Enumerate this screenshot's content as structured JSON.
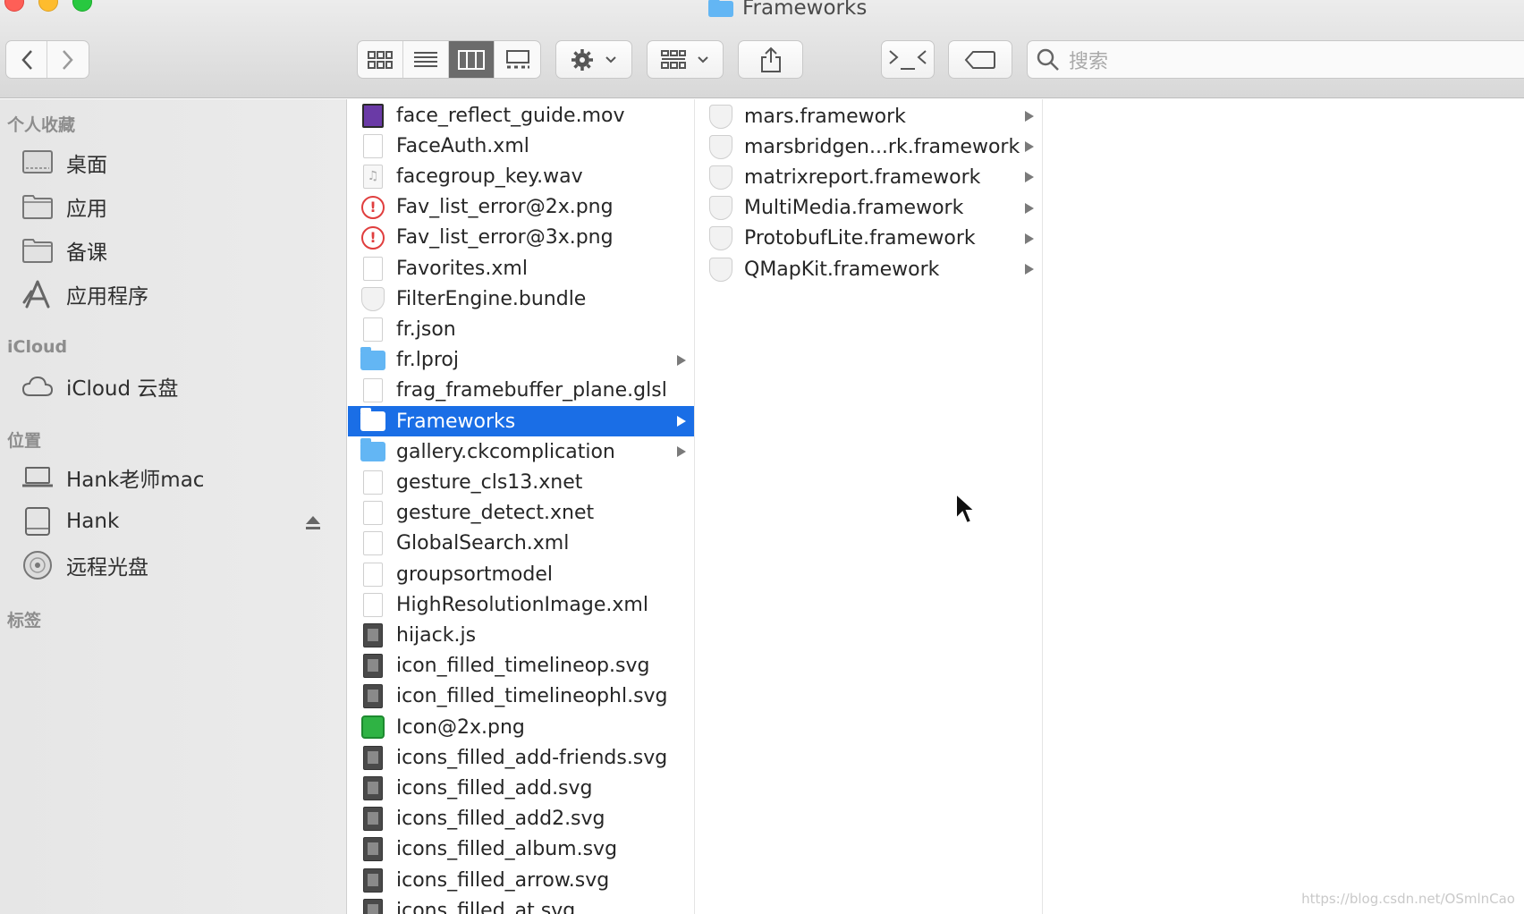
{
  "window": {
    "title": "Frameworks"
  },
  "toolbar": {
    "back_icon": "chevron-left-icon",
    "forward_icon": "chevron-right-icon",
    "view_modes": [
      "icon-view-icon",
      "list-view-icon",
      "column-view-icon",
      "gallery-view-icon"
    ],
    "active_view": "column-view-icon",
    "search_placeholder": "搜索"
  },
  "sidebar": {
    "sections": {
      "favorites": "个人收藏",
      "icloud": "iCloud",
      "locations": "位置",
      "tags": "标签"
    },
    "favorites": [
      {
        "label": "桌面",
        "icon": "desktop-icon"
      },
      {
        "label": "应用",
        "icon": "folder-icon"
      },
      {
        "label": "备课",
        "icon": "folder-icon"
      },
      {
        "label": "应用程序",
        "icon": "applications-icon"
      }
    ],
    "icloud": [
      {
        "label": "iCloud 云盘",
        "icon": "cloud-icon"
      }
    ],
    "locations": [
      {
        "label": "Hank老师mac",
        "icon": "laptop-icon"
      },
      {
        "label": "Hank",
        "icon": "disk-icon"
      },
      {
        "label": "远程光盘",
        "icon": "optical-disc-icon"
      }
    ]
  },
  "column1": [
    {
      "name": "face_reflect_guide.mov",
      "kind": "video"
    },
    {
      "name": "FaceAuth.xml",
      "kind": "doc"
    },
    {
      "name": "facegroup_key.wav",
      "kind": "audio"
    },
    {
      "name": "Fav_list_error@2x.png",
      "kind": "warn"
    },
    {
      "name": "Fav_list_error@3x.png",
      "kind": "warn"
    },
    {
      "name": "Favorites.xml",
      "kind": "doc"
    },
    {
      "name": "FilterEngine.bundle",
      "kind": "shield"
    },
    {
      "name": "fr.json",
      "kind": "doc"
    },
    {
      "name": "fr.lproj",
      "kind": "folder"
    },
    {
      "name": "frag_framebuffer_plane.glsl",
      "kind": "doc"
    },
    {
      "name": "Frameworks",
      "kind": "folder"
    },
    {
      "name": "gallery.ckcomplication",
      "kind": "folder"
    },
    {
      "name": "gesture_cls13.xnet",
      "kind": "doc"
    },
    {
      "name": "gesture_detect.xnet",
      "kind": "doc"
    },
    {
      "name": "GlobalSearch.xml",
      "kind": "doc"
    },
    {
      "name": "groupsortmodel",
      "kind": "doc"
    },
    {
      "name": "HighResolutionImage.xml",
      "kind": "doc"
    },
    {
      "name": "hijack.js",
      "kind": "dark"
    },
    {
      "name": "icon_filled_timelineop.svg",
      "kind": "dark"
    },
    {
      "name": "icon_filled_timelineophl.svg",
      "kind": "dark"
    },
    {
      "name": "Icon@2x.png",
      "kind": "green"
    },
    {
      "name": "icons_filled_add-friends.svg",
      "kind": "dark"
    },
    {
      "name": "icons_filled_add.svg",
      "kind": "dark"
    },
    {
      "name": "icons_filled_add2.svg",
      "kind": "dark"
    },
    {
      "name": "icons_filled_album.svg",
      "kind": "dark"
    },
    {
      "name": "icons_filled_arrow.svg",
      "kind": "dark"
    },
    {
      "name": "icons_filled_at.svg",
      "kind": "dark"
    }
  ],
  "column1_selected": "Frameworks",
  "column2": [
    {
      "name": "mars.framework",
      "kind": "shield"
    },
    {
      "name": "marsbridgen...rk.framework",
      "kind": "shield"
    },
    {
      "name": "matrixreport.framework",
      "kind": "shield"
    },
    {
      "name": "MultiMedia.framework",
      "kind": "shield"
    },
    {
      "name": "ProtobufLite.framework",
      "kind": "shield"
    },
    {
      "name": "QMapKit.framework",
      "kind": "shield"
    }
  ],
  "watermark": "https://blog.csdn.net/OSmlnCao"
}
